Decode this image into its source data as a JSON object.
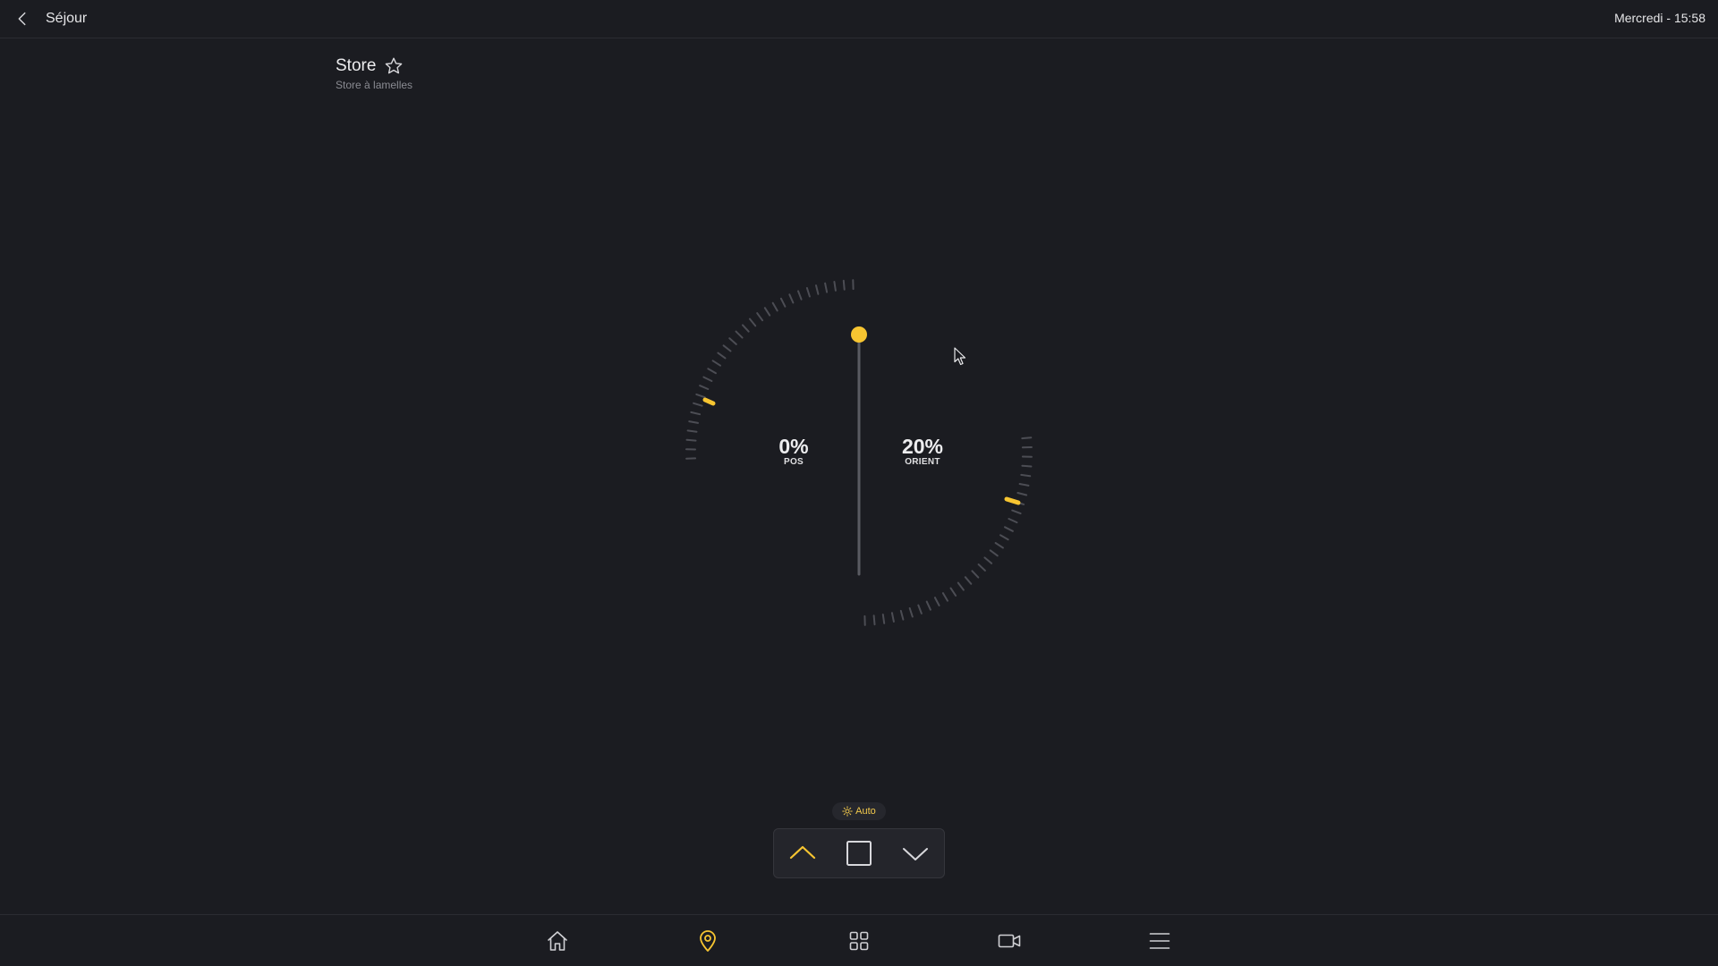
{
  "header": {
    "back_label": "Séjour",
    "datetime": "Mercredi - 15:58"
  },
  "device": {
    "title": "Store",
    "subtitle": "Store à lamelles"
  },
  "dial": {
    "position": {
      "value": "0%",
      "label": "POS"
    },
    "orientation": {
      "value": "20%",
      "label": "ORIENT"
    }
  },
  "auto_badge": {
    "label": "Auto"
  },
  "colors": {
    "accent": "#f7c531",
    "background": "#1b1c21",
    "tick": "#4c4d54"
  },
  "controls": {
    "up": "chevron-up-icon",
    "stop": "square-stop-icon",
    "down": "chevron-down-icon"
  },
  "nav": {
    "items": [
      "home-icon",
      "location-pin-icon",
      "grid-icon",
      "camera-icon",
      "menu-icon"
    ],
    "active": "location-pin-icon"
  }
}
